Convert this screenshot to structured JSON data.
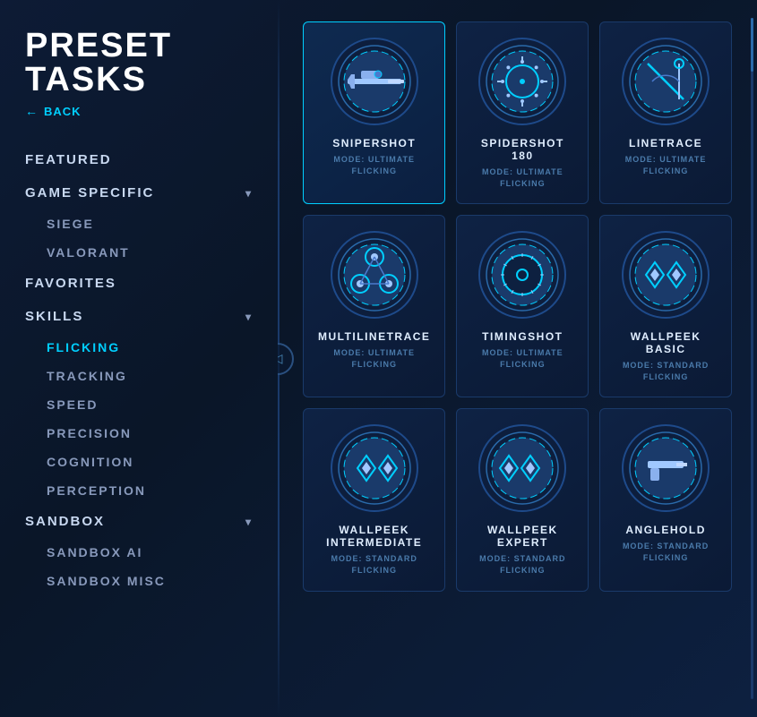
{
  "page": {
    "title": "PRESET TASKS",
    "back_label": "BACK"
  },
  "sidebar": {
    "nav_items": [
      {
        "id": "featured",
        "label": "FEATURED",
        "type": "top",
        "has_chevron": false,
        "active": false
      },
      {
        "id": "game_specific",
        "label": "GAME SPECIFIC",
        "type": "top",
        "has_chevron": true,
        "active": false
      },
      {
        "id": "siege",
        "label": "SIEGE",
        "type": "sub",
        "active": false
      },
      {
        "id": "valorant",
        "label": "VALORANT",
        "type": "sub",
        "active": false
      },
      {
        "id": "favorites",
        "label": "FAVORITES",
        "type": "top",
        "has_chevron": false,
        "active": false
      },
      {
        "id": "skills",
        "label": "SKILLS",
        "type": "top",
        "has_chevron": true,
        "active": false
      },
      {
        "id": "flicking",
        "label": "FLICKING",
        "type": "sub",
        "active": true
      },
      {
        "id": "tracking",
        "label": "TRACKING",
        "type": "sub",
        "active": false
      },
      {
        "id": "speed",
        "label": "SPEED",
        "type": "sub",
        "active": false
      },
      {
        "id": "precision",
        "label": "PRECISION",
        "type": "sub",
        "active": false
      },
      {
        "id": "cognition",
        "label": "COGNITION",
        "type": "sub",
        "active": false
      },
      {
        "id": "perception",
        "label": "PERCEPTION",
        "type": "sub",
        "active": false
      },
      {
        "id": "sandbox",
        "label": "SANDBOX",
        "type": "top",
        "has_chevron": true,
        "active": false
      },
      {
        "id": "sandbox_ai",
        "label": "SANDBOX AI",
        "type": "sub",
        "active": false
      },
      {
        "id": "sandbox_misc",
        "label": "SANDBOX MISC",
        "type": "sub",
        "active": false
      }
    ]
  },
  "tasks": [
    {
      "id": "snipershot",
      "name": "SNIPERSHOT",
      "mode_line1": "MODE: ULTIMATE",
      "mode_line2": "FLICKING",
      "selected": true,
      "icon_type": "sniper"
    },
    {
      "id": "spidershot_180",
      "name": "SPIDERSHOT 180",
      "mode_line1": "MODE: ULTIMATE",
      "mode_line2": "FLICKING",
      "selected": false,
      "icon_type": "crosshair_circle"
    },
    {
      "id": "linetrace",
      "name": "LINETRACE",
      "mode_line1": "MODE: ULTIMATE",
      "mode_line2": "FLICKING",
      "selected": false,
      "icon_type": "diagonal_lines"
    },
    {
      "id": "multilinetrace",
      "name": "MULTILINETRACE",
      "mode_line1": "MODE: ULTIMATE",
      "mode_line2": "FLICKING",
      "selected": false,
      "icon_type": "triangle_circles"
    },
    {
      "id": "timingshot",
      "name": "TIMINGSHOT",
      "mode_line1": "MODE: ULTIMATE",
      "mode_line2": "FLICKING",
      "selected": false,
      "icon_type": "target_crosshair"
    },
    {
      "id": "wallpeek_basic",
      "name": "WALLPEEK BASIC",
      "mode_line1": "MODE: STANDARD",
      "mode_line2": "FLICKING",
      "selected": false,
      "icon_type": "diamond_shapes"
    },
    {
      "id": "wallpeek_intermediate",
      "name": "WALLPEEK INTERMEDIATE",
      "mode_line1": "MODE: STANDARD",
      "mode_line2": "FLICKING",
      "selected": false,
      "icon_type": "diamond_shapes2"
    },
    {
      "id": "wallpeek_expert",
      "name": "WALLPEEK EXPERT",
      "mode_line1": "MODE: STANDARD",
      "mode_line2": "FLICKING",
      "selected": false,
      "icon_type": "diamond_shapes3"
    },
    {
      "id": "anglehold",
      "name": "ANGLEHOLD",
      "mode_line1": "MODE: STANDARD",
      "mode_line2": "FLICKING",
      "selected": false,
      "icon_type": "gun_shapes"
    }
  ]
}
